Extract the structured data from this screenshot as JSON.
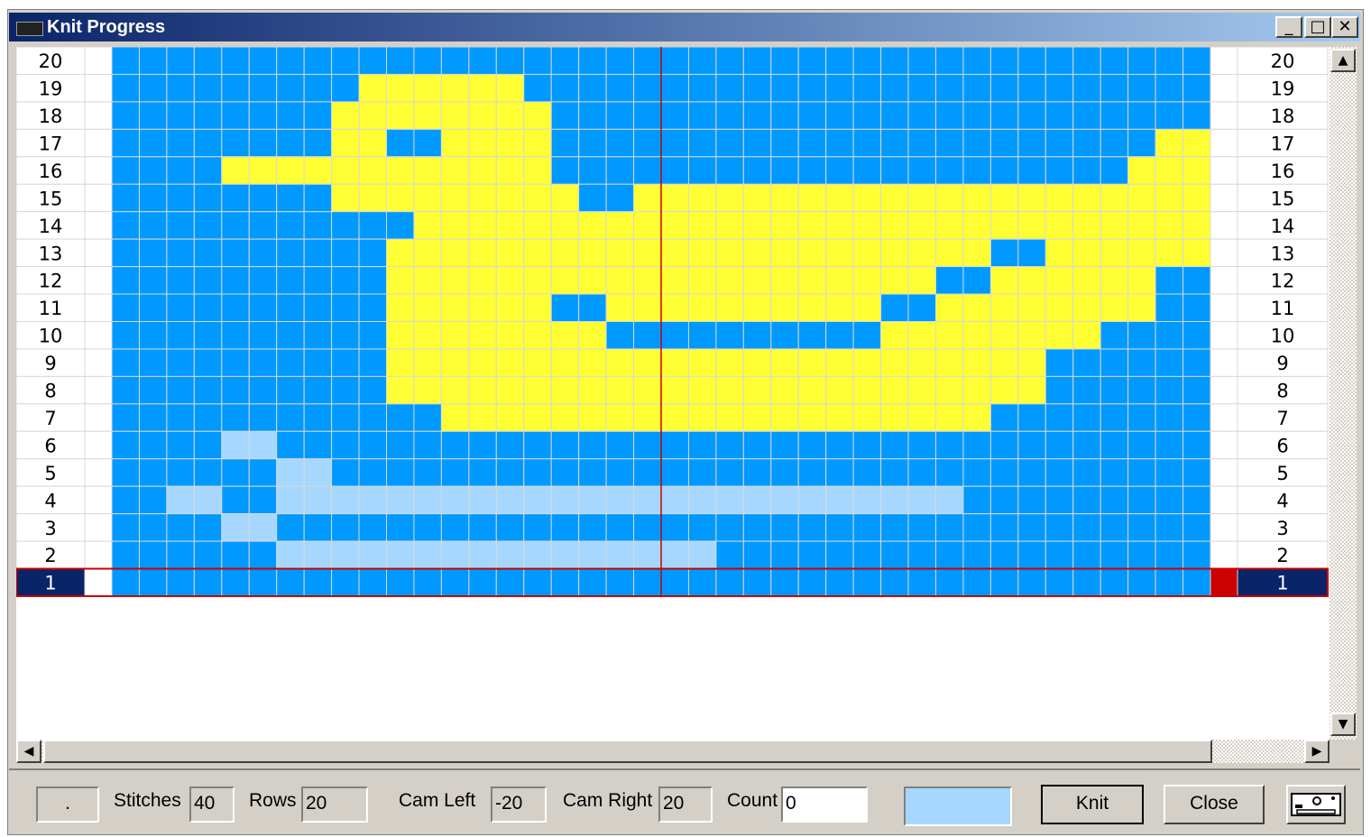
{
  "window": {
    "title": "Knit Progress",
    "minimize_label": "_",
    "maximize_label": "□",
    "close_label": "✕"
  },
  "colors": {
    "background": "#0099ff",
    "contrast": "#ffff33",
    "knitted": "#a6d8ff",
    "current_row_highlight": "#0a246a",
    "current_row_border": "#cc0000",
    "center_line": "#cc0000",
    "grid_line": "#d8d8d8"
  },
  "knitting": {
    "stitches_total": 40,
    "rows_total": 20,
    "current_row": 1,
    "legend": {
      ".": "background",
      "Y": "contrast yarn",
      "L": "knitted (light)"
    },
    "pattern_rows_top_to_bottom": [
      "........................................",
      ".........YYYYYY.........................",
      "........YYYYYYYY........................",
      "........YY..YYYY......................YY",
      "....YYYYYYYYYYYY.....................YYY",
      "........YYYYYYYYY..YYYYYYYYYYYYYYYYYYYYY",
      "...........YYYYYYYYYYYYYYYYYYYYYYYYYYYYY",
      "..........YYYYYYYYYYYYYYYYYYYYYY..YYYYYY",
      "..........YYYYYYYYYYYYYYYYYYYY..YYYYYY..",
      "..........YYYYYY..YYYYYYYYYY..YYYYYYYY..",
      "..........YYYYYYYY..........YYYYYYYY....",
      "..........YYYYYYYYYYYYYYYYYYYYYYYY......",
      "..........YYYYYYYYYYYYYYYYYYYYYYYY......",
      "............YYYYYYYYYYYYYYYYYYYY........",
      "....LL..................................",
      "......LL................................",
      "..LL..LLLLLLLLLLLLLLLLLLLLLLLLL.........",
      "....LL..................................",
      "......LLLLLLLLLLLLLLLL..................",
      "........................................"
    ],
    "row_labels_top_to_bottom": [
      "20",
      "19",
      "18",
      "17",
      "16",
      "15",
      "14",
      "13",
      "12",
      "11",
      "10",
      "9",
      "8",
      "7",
      "6",
      "5",
      "4",
      "3",
      "2",
      "1"
    ]
  },
  "scrollbar": {
    "up_icon": "▲",
    "down_icon": "▼",
    "left_icon": "◀",
    "right_icon": "▶"
  },
  "bottom": {
    "status_box": ".",
    "stitches_label": "Stitches",
    "stitches_value": "40",
    "rows_label": "Rows",
    "rows_value": "20",
    "cam_left_label": "Cam Left",
    "cam_left_value": "-20",
    "cam_right_label": "Cam Right",
    "cam_right_value": "20",
    "count_label": "Count",
    "count_value": "0",
    "knit_button": "Knit",
    "close_button": "Close",
    "machine_icon": "knitting-machine-icon"
  }
}
